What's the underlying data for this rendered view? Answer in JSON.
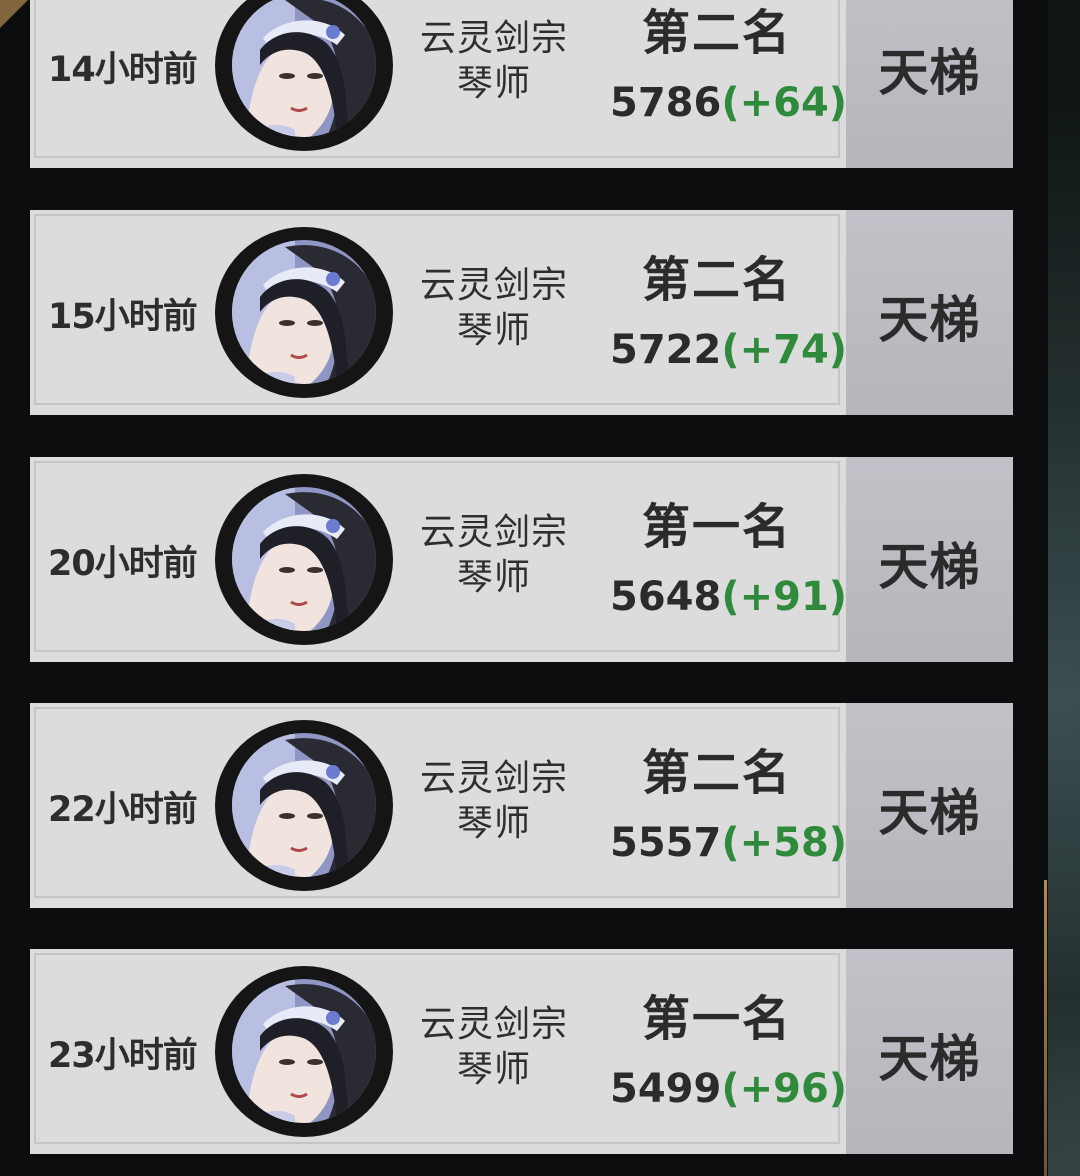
{
  "records": [
    {
      "time": "14小时前",
      "sect": "云灵剑宗",
      "role": "琴师",
      "rank": "第二名",
      "score": "5786",
      "delta": "(+64)",
      "mode": "天梯"
    },
    {
      "time": "15小时前",
      "sect": "云灵剑宗",
      "role": "琴师",
      "rank": "第二名",
      "score": "5722",
      "delta": "(+74)",
      "mode": "天梯"
    },
    {
      "time": "20小时前",
      "sect": "云灵剑宗",
      "role": "琴师",
      "rank": "第一名",
      "score": "5648",
      "delta": "(+91)",
      "mode": "天梯"
    },
    {
      "time": "22小时前",
      "sect": "云灵剑宗",
      "role": "琴师",
      "rank": "第二名",
      "score": "5557",
      "delta": "(+58)",
      "mode": "天梯"
    },
    {
      "time": "23小时前",
      "sect": "云灵剑宗",
      "role": "琴师",
      "rank": "第一名",
      "score": "5499",
      "delta": "(+96)",
      "mode": "天梯"
    }
  ],
  "colors": {
    "delta": "#2f8a3c",
    "card": "#dcdcdc",
    "side": "#c3c0c8"
  }
}
